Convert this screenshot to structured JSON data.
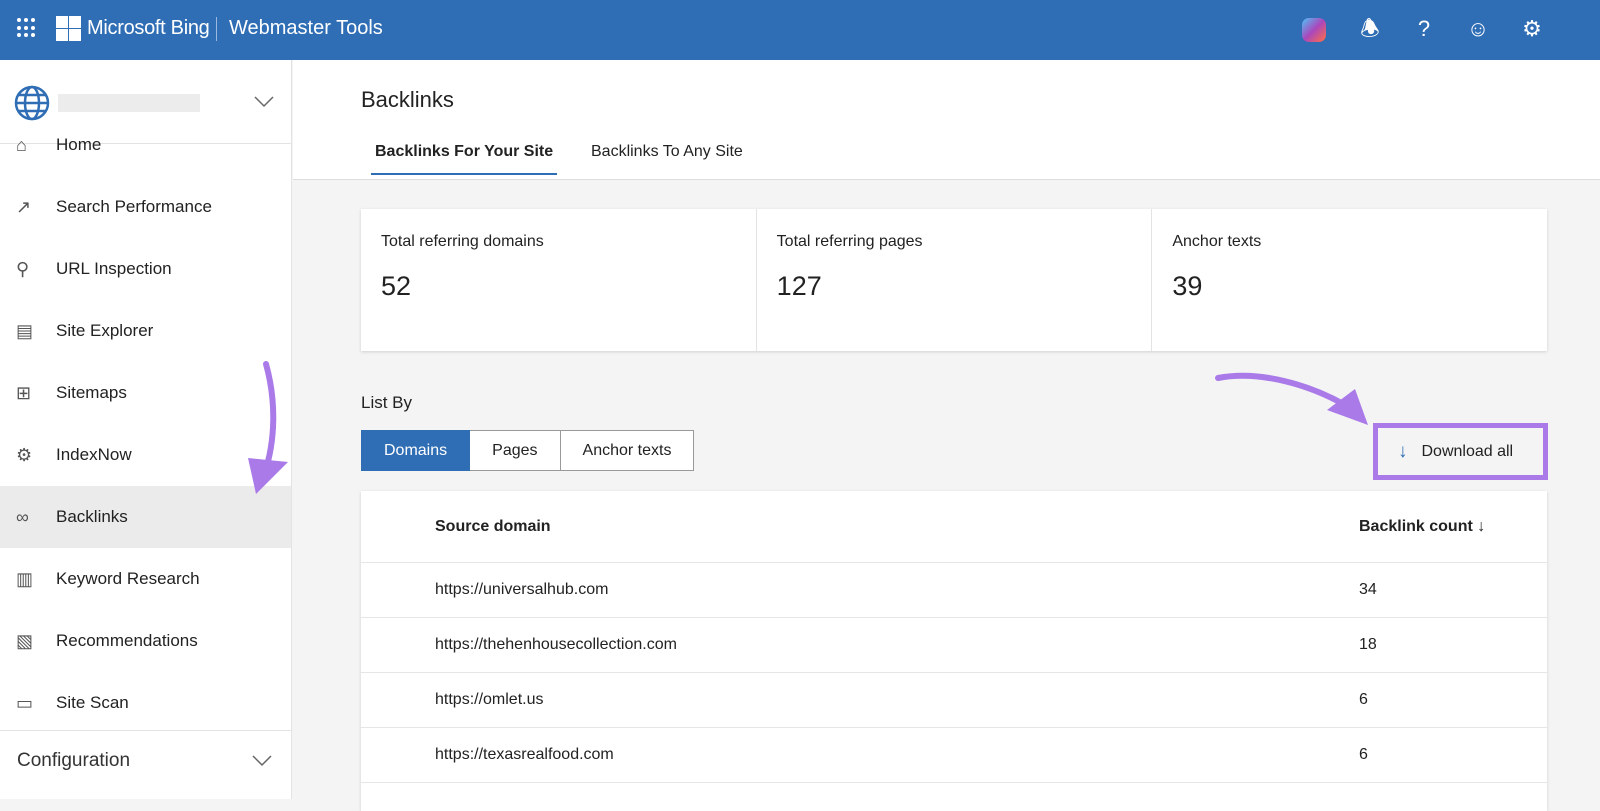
{
  "header": {
    "brand": "Microsoft Bing",
    "product": "Webmaster Tools",
    "icons": [
      "copilot-icon",
      "bell-icon",
      "help-icon",
      "feedback-smiley-icon",
      "gear-icon"
    ]
  },
  "sidebar": {
    "items": [
      {
        "label": "Home",
        "icon": "home-icon"
      },
      {
        "label": "Search Performance",
        "icon": "trend-icon"
      },
      {
        "label": "URL Inspection",
        "icon": "search-icon"
      },
      {
        "label": "Site Explorer",
        "icon": "document-icon"
      },
      {
        "label": "Sitemaps",
        "icon": "sitemap-icon"
      },
      {
        "label": "IndexNow",
        "icon": "gear-icon"
      },
      {
        "label": "Backlinks",
        "icon": "link-icon",
        "active": true
      },
      {
        "label": "Keyword Research",
        "icon": "list-icon"
      },
      {
        "label": "Recommendations",
        "icon": "recommendation-icon"
      },
      {
        "label": "Site Scan",
        "icon": "scan-icon"
      }
    ],
    "config": "Configuration"
  },
  "page": {
    "title": "Backlinks",
    "tabs": [
      "Backlinks For Your Site",
      "Backlinks To Any Site"
    ]
  },
  "stats": [
    {
      "label": "Total referring domains",
      "value": "52"
    },
    {
      "label": "Total referring pages",
      "value": "127"
    },
    {
      "label": "Anchor texts",
      "value": "39"
    }
  ],
  "list_by": {
    "label": "List By",
    "options": [
      "Domains",
      "Pages",
      "Anchor texts"
    ],
    "selected": "Domains"
  },
  "download_label": "Download all",
  "table": {
    "headers": [
      "Source domain",
      "Backlink count ↓"
    ],
    "rows": [
      [
        "https://universalhub.com",
        "34"
      ],
      [
        "https://thehenhousecollection.com",
        "18"
      ],
      [
        "https://omlet.us",
        "6"
      ],
      [
        "https://texasrealfood.com",
        "6"
      ]
    ]
  },
  "colors": {
    "accent": "#2f6db5",
    "annotation": "#a97ae8"
  }
}
